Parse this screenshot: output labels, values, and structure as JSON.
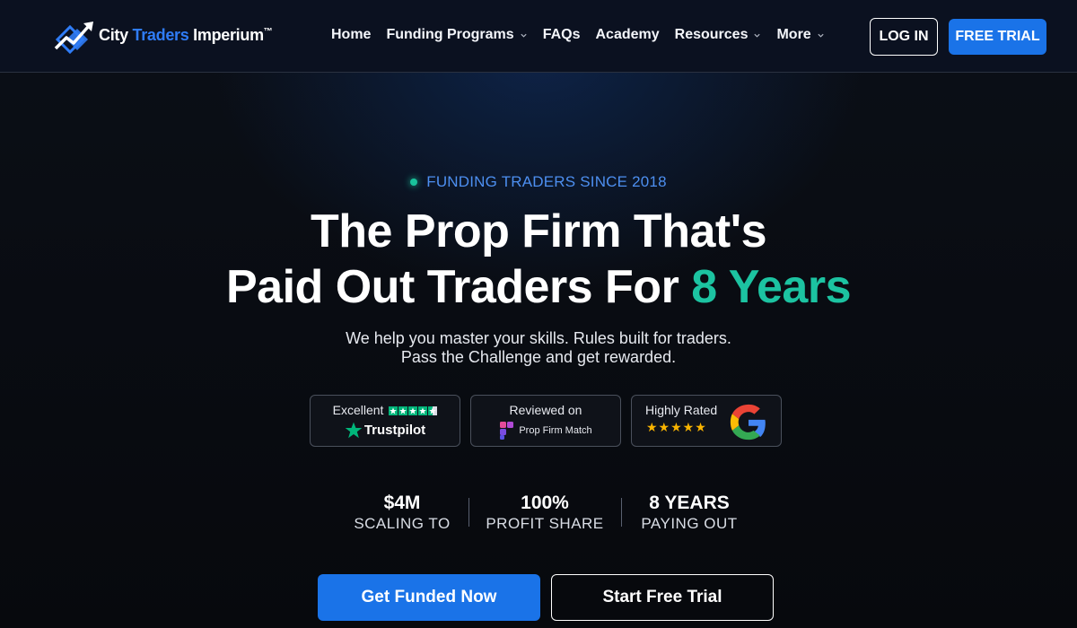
{
  "nav": {
    "logo": {
      "part1": "City ",
      "part2": "Traders",
      "part3": " Imperium",
      "tm": "™"
    },
    "links": [
      {
        "label": "Home",
        "has_dropdown": false
      },
      {
        "label": "Funding Programs",
        "has_dropdown": true
      },
      {
        "label": "FAQs",
        "has_dropdown": false
      },
      {
        "label": "Academy",
        "has_dropdown": false
      },
      {
        "label": "Resources",
        "has_dropdown": true
      },
      {
        "label": "More",
        "has_dropdown": true
      }
    ],
    "login_label": "LOG IN",
    "free_trial_label": "FREE TRIAL"
  },
  "hero": {
    "eyebrow": "FUNDING TRADERS SINCE 2018",
    "headline_line1": "The Prop Firm That's",
    "headline_line2_prefix": "Paid Out Traders For ",
    "headline_line2_accent": "8 Years",
    "subtext_line1": "We help you master your skills. Rules built for traders.",
    "subtext_line2": "Pass the Challenge and get rewarded."
  },
  "badges": {
    "trustpilot": {
      "rating_text": "Excellent",
      "brand": "Trustpilot",
      "stars": 4.5
    },
    "propfirmmatch": {
      "line1": "Reviewed on",
      "brand": "Prop Firm Match"
    },
    "google": {
      "line1": "Highly Rated",
      "stars_text": "★★★★★"
    }
  },
  "stats": [
    {
      "value": "$4M",
      "label": "SCALING TO"
    },
    {
      "value": "100%",
      "label": "PROFIT SHARE"
    },
    {
      "value": "8 YEARS",
      "label": "PAYING OUT"
    }
  ],
  "cta": {
    "primary": "Get Funded Now",
    "secondary": "Start Free Trial"
  },
  "colors": {
    "brand_blue": "#1a73e8",
    "accent_teal": "#1cc3a1",
    "eyebrow_blue": "#4d8ff0",
    "trustpilot_green": "#00b67a"
  }
}
